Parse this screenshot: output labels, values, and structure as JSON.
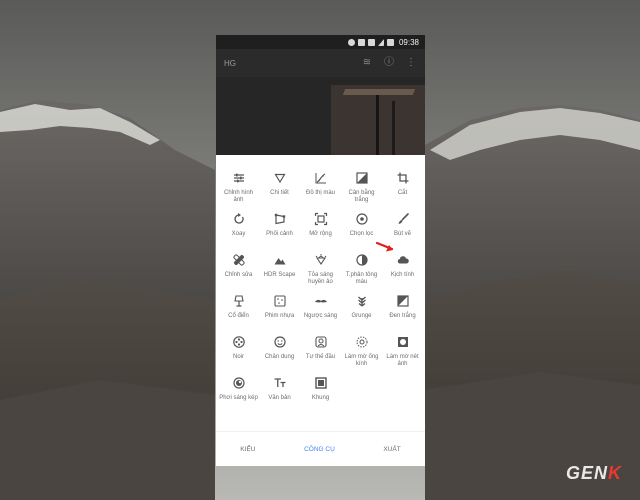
{
  "status_bar": {
    "time": "09:38"
  },
  "app_bar": {
    "title": "HG"
  },
  "tools": [
    {
      "id": "tune",
      "label": "Chỉnh hình ảnh",
      "icon": "tune-sliders-icon"
    },
    {
      "id": "details",
      "label": "Chi tiết",
      "icon": "triangle-details-icon"
    },
    {
      "id": "curves",
      "label": "Đồ thị màu",
      "icon": "curves-icon"
    },
    {
      "id": "wb",
      "label": "Cân bằng trắng",
      "icon": "white-balance-icon"
    },
    {
      "id": "crop",
      "label": "Cắt",
      "icon": "crop-icon"
    },
    {
      "id": "rotate",
      "label": "Xoay",
      "icon": "rotate-icon"
    },
    {
      "id": "perspective",
      "label": "Phối cảnh",
      "icon": "perspective-icon"
    },
    {
      "id": "expand",
      "label": "Mở rộng",
      "icon": "expand-icon"
    },
    {
      "id": "selective",
      "label": "Chọn lọc",
      "icon": "selective-target-icon"
    },
    {
      "id": "brush",
      "label": "Bút vẽ",
      "icon": "brush-icon"
    },
    {
      "id": "healing",
      "label": "Chỉnh sửa",
      "icon": "healing-bandage-icon"
    },
    {
      "id": "hdr",
      "label": "HDR Scape",
      "icon": "mountain-hdr-icon"
    },
    {
      "id": "glamour",
      "label": "Tỏa sáng huyền ảo",
      "icon": "diamond-glow-icon"
    },
    {
      "id": "tonal",
      "label": "T.phản tông màu",
      "icon": "tonal-contrast-icon"
    },
    {
      "id": "drama",
      "label": "Kịch tính",
      "icon": "cloud-drama-icon"
    },
    {
      "id": "vintage",
      "label": "Cổ điển",
      "icon": "lamp-vintage-icon"
    },
    {
      "id": "grainy",
      "label": "Phim nhựa",
      "icon": "film-grain-icon"
    },
    {
      "id": "retrolux",
      "label": "Ngược sáng",
      "icon": "mustache-retrolux-icon"
    },
    {
      "id": "grunge",
      "label": "Grunge",
      "icon": "grunge-leaf-icon"
    },
    {
      "id": "bw",
      "label": "Đen trắng",
      "icon": "black-white-icon"
    },
    {
      "id": "noir",
      "label": "Noir",
      "icon": "film-reel-noir-icon"
    },
    {
      "id": "portrait",
      "label": "Chân dung",
      "icon": "face-portrait-icon"
    },
    {
      "id": "headpose",
      "label": "Tư thế đầu",
      "icon": "head-pose-icon"
    },
    {
      "id": "lensblur",
      "label": "Làm mờ ống kính",
      "icon": "lens-blur-icon"
    },
    {
      "id": "vignette",
      "label": "Làm mờ nét ảnh",
      "icon": "vignette-icon"
    },
    {
      "id": "double",
      "label": "Phơi sáng kép",
      "icon": "double-exposure-icon"
    },
    {
      "id": "text",
      "label": "Văn bản",
      "icon": "text-tt-icon"
    },
    {
      "id": "frames",
      "label": "Khung",
      "icon": "frame-icon"
    }
  ],
  "bottom_tabs": [
    {
      "label": "KIỂU",
      "active": false
    },
    {
      "label": "CÔNG CỤ",
      "active": true
    },
    {
      "label": "XUẤT",
      "active": false
    }
  ],
  "colors": {
    "accent": "#4285f4",
    "arrow": "#e0201a",
    "icon": "#555555"
  },
  "watermark": {
    "text_main": "GEN",
    "text_accent": "K"
  }
}
